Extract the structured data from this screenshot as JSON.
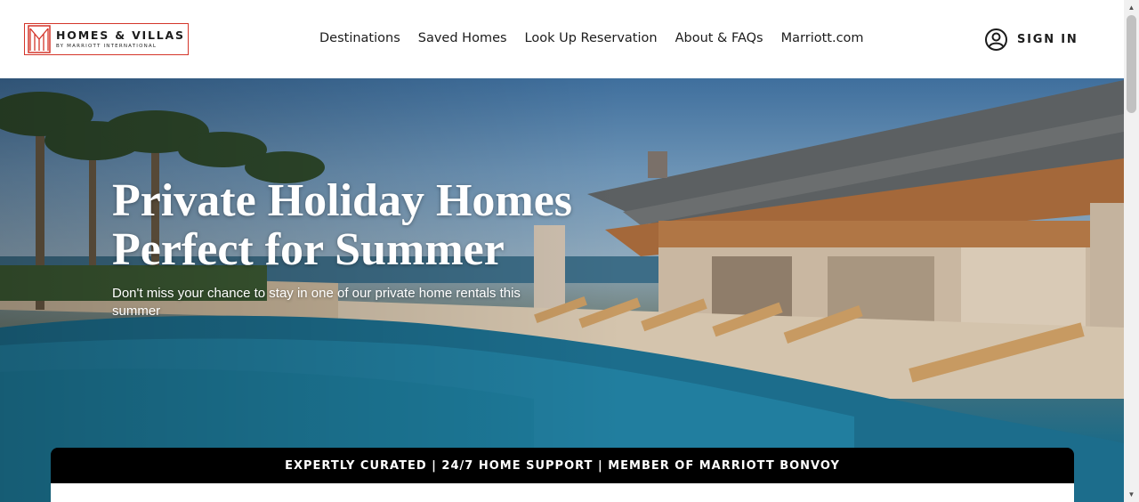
{
  "brand": {
    "name": "HOMES & VILLAS",
    "tagline": "BY MARRIOTT INTERNATIONAL",
    "accent_color": "#d4352a"
  },
  "nav": {
    "items": [
      {
        "label": "Destinations"
      },
      {
        "label": "Saved Homes"
      },
      {
        "label": "Look Up Reservation"
      },
      {
        "label": "About & FAQs"
      },
      {
        "label": "Marriott.com"
      }
    ]
  },
  "account": {
    "icon": "user-circle-icon",
    "sign_in_label": "SIGN IN"
  },
  "hero": {
    "title_line1": "Private Holiday Homes",
    "title_line2": "Perfect for Summer",
    "subtitle": "Don't miss your chance to stay in one of our private home rentals this summer"
  },
  "banner": {
    "text": "EXPERTLY CURATED | 24/7 HOME SUPPORT | MEMBER OF MARRIOTT BONVOY"
  },
  "scrollbar": {
    "up_icon": "triangle-up-icon",
    "down_icon": "triangle-down-icon"
  }
}
